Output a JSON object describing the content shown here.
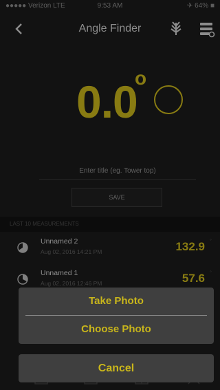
{
  "status_bar": {
    "carrier": "●●●●● Verizon LTE",
    "time": "9:53 AM",
    "battery": "✈ 64% ■"
  },
  "nav": {
    "title": "Angle Finder",
    "back_icon": "chevron-left-icon",
    "leaf_icon": "leaf-icon",
    "settings_icon": "settings-icon"
  },
  "measurement": {
    "value": "0.0",
    "unit_symbol": "o"
  },
  "form": {
    "title_placeholder": "Enter title (eg. Tower top)",
    "save_label": "SAVE"
  },
  "history": {
    "header": "LAST 10 MEASUREMENTS",
    "items": [
      {
        "name": "Unnamed 2",
        "date": "Aug 02, 2016 14:21 PM",
        "angle": "132.9",
        "tick": "˚"
      },
      {
        "name": "Unnamed 1",
        "date": "Aug 02, 2016 12:46 PM",
        "angle": "57.6",
        "tick": "˚"
      }
    ]
  },
  "action_sheet": {
    "take_photo": "Take Photo",
    "choose_photo": "Choose Photo",
    "cancel": "Cancel"
  },
  "colors": {
    "accent": "#c9b61b",
    "background": "#1b1b1b",
    "sheet": "#3f3f3f"
  }
}
